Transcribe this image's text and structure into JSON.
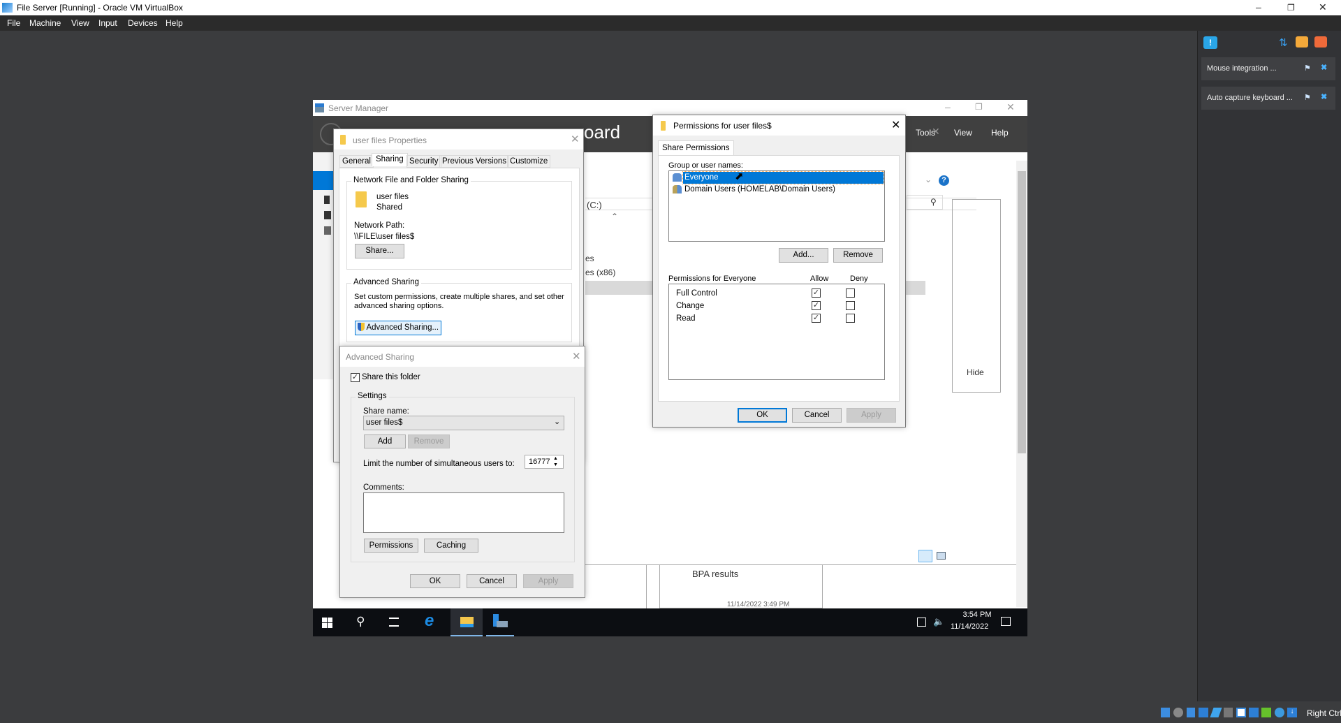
{
  "host": {
    "title": "File Server [Running] - Oracle VM VirtualBox",
    "menu": [
      "File",
      "Machine",
      "View",
      "Input",
      "Devices",
      "Help"
    ],
    "notifications": [
      {
        "text": "Mouse integration ..."
      },
      {
        "text": "Auto capture keyboard ..."
      }
    ],
    "host_key": "Right Ctrl"
  },
  "server_manager": {
    "title": "Server Manager",
    "header_partial": "oard",
    "menu": [
      "Tools",
      "View",
      "Help"
    ],
    "drive_partial": "(C:)",
    "list_partial": [
      "es",
      "es (x86)"
    ],
    "hide_label": "Hide",
    "bpa_label": "BPA results",
    "bpa_time_partial": "11/14/2022 3:49 PM"
  },
  "properties": {
    "title": "user files Properties",
    "tabs": [
      "General",
      "Sharing",
      "Security",
      "Previous Versions",
      "Customize"
    ],
    "active_tab": "Sharing",
    "nffs_group": "Network File and Folder Sharing",
    "folder_name": "user files",
    "folder_state": "Shared",
    "network_path_label": "Network Path:",
    "network_path": "\\\\FILE\\user files$",
    "share_button": "Share...",
    "adv_group": "Advanced Sharing",
    "adv_desc_1": "Set custom permissions, create multiple shares, and set other",
    "adv_desc_2": "advanced sharing options.",
    "adv_button": "Advanced Sharing..."
  },
  "advanced": {
    "title": "Advanced Sharing",
    "share_checkbox": "Share this folder",
    "share_checked": true,
    "settings_group": "Settings",
    "share_name_label": "Share name:",
    "share_name": "user files$",
    "add": "Add",
    "remove": "Remove",
    "limit_label": "Limit the number of simultaneous users to:",
    "limit_value": "16777",
    "comments_label": "Comments:",
    "comments": "",
    "permissions": "Permissions",
    "caching": "Caching",
    "ok": "OK",
    "cancel": "Cancel",
    "apply": "Apply"
  },
  "permissions": {
    "title": "Permissions for user files$",
    "tab": "Share Permissions",
    "group_label": "Group or user names:",
    "users": [
      "Everyone",
      "Domain Users (HOMELAB\\Domain Users)"
    ],
    "selected_user": "Everyone",
    "add": "Add...",
    "remove": "Remove",
    "perm_label": "Permissions for Everyone",
    "allow": "Allow",
    "deny": "Deny",
    "rows": [
      {
        "name": "Full Control",
        "allow": true,
        "deny": false
      },
      {
        "name": "Change",
        "allow": true,
        "deny": false
      },
      {
        "name": "Read",
        "allow": true,
        "deny": false
      }
    ],
    "ok": "OK",
    "cancel": "Cancel",
    "apply": "Apply"
  },
  "taskbar": {
    "time": "3:54 PM",
    "date": "11/14/2022"
  },
  "colors": {
    "accent": "#0078d7",
    "sm_header": "#404040",
    "taskbar": "#0c0e12"
  }
}
